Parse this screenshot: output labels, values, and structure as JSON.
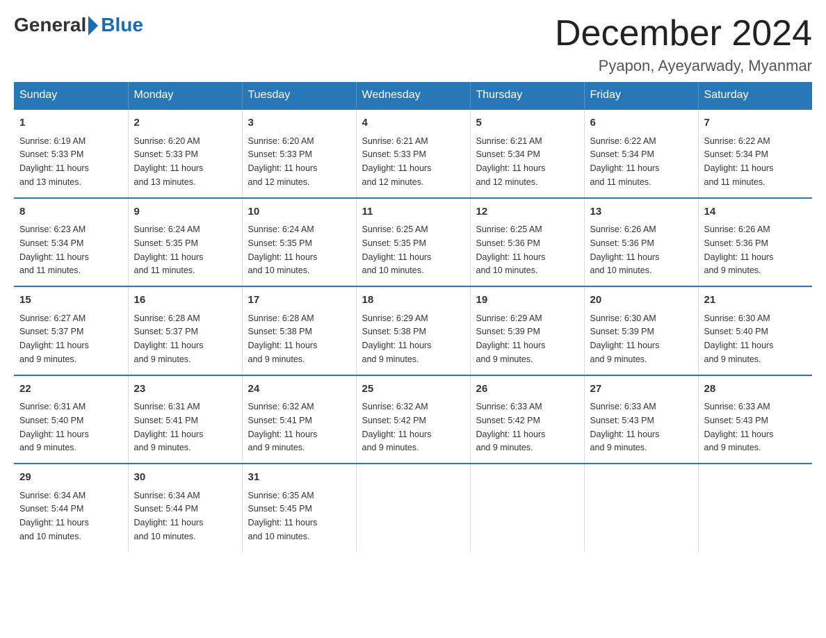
{
  "logo": {
    "general": "General",
    "blue": "Blue"
  },
  "title": "December 2024",
  "location": "Pyapon, Ayeyarwady, Myanmar",
  "days_header": [
    "Sunday",
    "Monday",
    "Tuesday",
    "Wednesday",
    "Thursday",
    "Friday",
    "Saturday"
  ],
  "weeks": [
    [
      {
        "day": "1",
        "sunrise": "6:19 AM",
        "sunset": "5:33 PM",
        "daylight": "11 hours and 13 minutes."
      },
      {
        "day": "2",
        "sunrise": "6:20 AM",
        "sunset": "5:33 PM",
        "daylight": "11 hours and 13 minutes."
      },
      {
        "day": "3",
        "sunrise": "6:20 AM",
        "sunset": "5:33 PM",
        "daylight": "11 hours and 12 minutes."
      },
      {
        "day": "4",
        "sunrise": "6:21 AM",
        "sunset": "5:33 PM",
        "daylight": "11 hours and 12 minutes."
      },
      {
        "day": "5",
        "sunrise": "6:21 AM",
        "sunset": "5:34 PM",
        "daylight": "11 hours and 12 minutes."
      },
      {
        "day": "6",
        "sunrise": "6:22 AM",
        "sunset": "5:34 PM",
        "daylight": "11 hours and 11 minutes."
      },
      {
        "day": "7",
        "sunrise": "6:22 AM",
        "sunset": "5:34 PM",
        "daylight": "11 hours and 11 minutes."
      }
    ],
    [
      {
        "day": "8",
        "sunrise": "6:23 AM",
        "sunset": "5:34 PM",
        "daylight": "11 hours and 11 minutes."
      },
      {
        "day": "9",
        "sunrise": "6:24 AM",
        "sunset": "5:35 PM",
        "daylight": "11 hours and 11 minutes."
      },
      {
        "day": "10",
        "sunrise": "6:24 AM",
        "sunset": "5:35 PM",
        "daylight": "11 hours and 10 minutes."
      },
      {
        "day": "11",
        "sunrise": "6:25 AM",
        "sunset": "5:35 PM",
        "daylight": "11 hours and 10 minutes."
      },
      {
        "day": "12",
        "sunrise": "6:25 AM",
        "sunset": "5:36 PM",
        "daylight": "11 hours and 10 minutes."
      },
      {
        "day": "13",
        "sunrise": "6:26 AM",
        "sunset": "5:36 PM",
        "daylight": "11 hours and 10 minutes."
      },
      {
        "day": "14",
        "sunrise": "6:26 AM",
        "sunset": "5:36 PM",
        "daylight": "11 hours and 9 minutes."
      }
    ],
    [
      {
        "day": "15",
        "sunrise": "6:27 AM",
        "sunset": "5:37 PM",
        "daylight": "11 hours and 9 minutes."
      },
      {
        "day": "16",
        "sunrise": "6:28 AM",
        "sunset": "5:37 PM",
        "daylight": "11 hours and 9 minutes."
      },
      {
        "day": "17",
        "sunrise": "6:28 AM",
        "sunset": "5:38 PM",
        "daylight": "11 hours and 9 minutes."
      },
      {
        "day": "18",
        "sunrise": "6:29 AM",
        "sunset": "5:38 PM",
        "daylight": "11 hours and 9 minutes."
      },
      {
        "day": "19",
        "sunrise": "6:29 AM",
        "sunset": "5:39 PM",
        "daylight": "11 hours and 9 minutes."
      },
      {
        "day": "20",
        "sunrise": "6:30 AM",
        "sunset": "5:39 PM",
        "daylight": "11 hours and 9 minutes."
      },
      {
        "day": "21",
        "sunrise": "6:30 AM",
        "sunset": "5:40 PM",
        "daylight": "11 hours and 9 minutes."
      }
    ],
    [
      {
        "day": "22",
        "sunrise": "6:31 AM",
        "sunset": "5:40 PM",
        "daylight": "11 hours and 9 minutes."
      },
      {
        "day": "23",
        "sunrise": "6:31 AM",
        "sunset": "5:41 PM",
        "daylight": "11 hours and 9 minutes."
      },
      {
        "day": "24",
        "sunrise": "6:32 AM",
        "sunset": "5:41 PM",
        "daylight": "11 hours and 9 minutes."
      },
      {
        "day": "25",
        "sunrise": "6:32 AM",
        "sunset": "5:42 PM",
        "daylight": "11 hours and 9 minutes."
      },
      {
        "day": "26",
        "sunrise": "6:33 AM",
        "sunset": "5:42 PM",
        "daylight": "11 hours and 9 minutes."
      },
      {
        "day": "27",
        "sunrise": "6:33 AM",
        "sunset": "5:43 PM",
        "daylight": "11 hours and 9 minutes."
      },
      {
        "day": "28",
        "sunrise": "6:33 AM",
        "sunset": "5:43 PM",
        "daylight": "11 hours and 9 minutes."
      }
    ],
    [
      {
        "day": "29",
        "sunrise": "6:34 AM",
        "sunset": "5:44 PM",
        "daylight": "11 hours and 10 minutes."
      },
      {
        "day": "30",
        "sunrise": "6:34 AM",
        "sunset": "5:44 PM",
        "daylight": "11 hours and 10 minutes."
      },
      {
        "day": "31",
        "sunrise": "6:35 AM",
        "sunset": "5:45 PM",
        "daylight": "11 hours and 10 minutes."
      },
      null,
      null,
      null,
      null
    ]
  ],
  "sunrise_label": "Sunrise:",
  "sunset_label": "Sunset:",
  "daylight_label": "Daylight:",
  "colors": {
    "header_bg": "#2878b8",
    "header_text": "#ffffff",
    "border": "#2878b8"
  }
}
